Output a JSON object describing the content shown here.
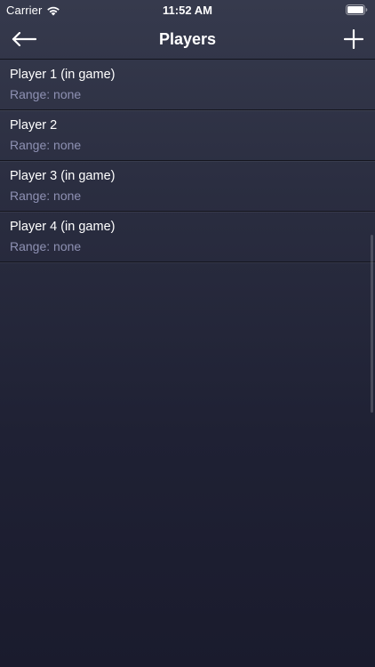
{
  "status_bar": {
    "carrier": "Carrier",
    "time": "11:52 AM",
    "wifi_icon": "wifi-icon",
    "battery_icon": "battery-icon"
  },
  "nav": {
    "title": "Players",
    "back_icon": "arrow-left-icon",
    "add_icon": "plus-icon"
  },
  "players": [
    {
      "name": "Player 1 (in game)",
      "range": "Range: none"
    },
    {
      "name": "Player 2",
      "range": "Range: none"
    },
    {
      "name": "Player 3 (in game)",
      "range": "Range: none"
    },
    {
      "name": "Player 4 (in game)",
      "range": "Range: none"
    }
  ],
  "colors": {
    "background_top": "#363a4d",
    "background_bottom": "#1a1b2d",
    "subtitle": "#8e91b3",
    "text": "#ffffff"
  }
}
